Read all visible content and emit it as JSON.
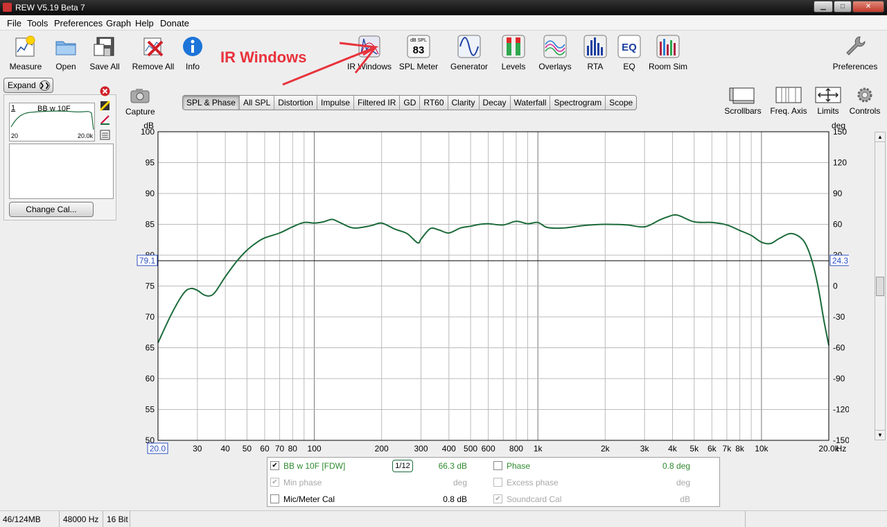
{
  "window": {
    "title": "REW V5.19 Beta 7"
  },
  "menu": [
    "File",
    "Tools",
    "Preferences",
    "Graph",
    "Help",
    "Donate"
  ],
  "toolbar": {
    "measure": "Measure",
    "open": "Open",
    "save_all": "Save All",
    "remove_all": "Remove All",
    "info": "Info",
    "ir_windows": "IR Windows",
    "spl_meter": "SPL Meter",
    "spl_meter_icon_top": "dB SPL",
    "spl_meter_icon_value": "83",
    "generator": "Generator",
    "levels": "Levels",
    "overlays": "Overlays",
    "rta": "RTA",
    "eq": "EQ",
    "eq_icon_text": "EQ",
    "room_sim": "Room Sim",
    "preferences": "Preferences"
  },
  "annotation": {
    "text": "IR Windows",
    "color": "#e8323c"
  },
  "left_panel": {
    "expand": "Expand",
    "measurement": {
      "number": "1",
      "name": "BB w 10F",
      "f_min": "20",
      "f_max": "20.0k"
    },
    "change_cal": "Change Cal..."
  },
  "capture": "Capture",
  "graph_tabs": [
    "SPL & Phase",
    "All SPL",
    "Distortion",
    "Impulse",
    "Filtered IR",
    "GD",
    "RT60",
    "Clarity",
    "Decay",
    "Waterfall",
    "Spectrogram",
    "Scope"
  ],
  "active_tab": "SPL & Phase",
  "right_tools": {
    "scrollbars": "Scrollbars",
    "freq_axis": "Freq. Axis",
    "limits": "Limits",
    "controls": "Controls"
  },
  "chart_data": {
    "type": "line",
    "x_scale": "log",
    "xlim": [
      20,
      20000
    ],
    "ylim": [
      50,
      100
    ],
    "y2lim": [
      -150,
      150
    ],
    "ylabel": "dB",
    "y2label": "deg",
    "xunit": "Hz",
    "y_ticks": [
      "100",
      "95",
      "90",
      "85",
      "80",
      "75",
      "70",
      "65",
      "60",
      "55",
      "50"
    ],
    "y2_ticks": [
      "150",
      "120",
      "90",
      "60",
      "30",
      "0",
      "-30",
      "-60",
      "-90",
      "-120",
      "-150"
    ],
    "x_tick_labels": [
      {
        "f": 30,
        "label": "30"
      },
      {
        "f": 40,
        "label": "40"
      },
      {
        "f": 50,
        "label": "50"
      },
      {
        "f": 60,
        "label": "60"
      },
      {
        "f": 70,
        "label": "70"
      },
      {
        "f": 80,
        "label": "80"
      },
      {
        "f": 100,
        "label": "100"
      },
      {
        "f": 200,
        "label": "200"
      },
      {
        "f": 300,
        "label": "300"
      },
      {
        "f": 400,
        "label": "400"
      },
      {
        "f": 500,
        "label": "500"
      },
      {
        "f": 600,
        "label": "600"
      },
      {
        "f": 800,
        "label": "800"
      },
      {
        "f": 1000,
        "label": "1k"
      },
      {
        "f": 2000,
        "label": "2k"
      },
      {
        "f": 3000,
        "label": "3k"
      },
      {
        "f": 4000,
        "label": "4k"
      },
      {
        "f": 5000,
        "label": "5k"
      },
      {
        "f": 6000,
        "label": "6k"
      },
      {
        "f": 7000,
        "label": "7k"
      },
      {
        "f": 8000,
        "label": "8k"
      },
      {
        "f": 10000,
        "label": "10k"
      },
      {
        "f": 20000,
        "label": "20.0k"
      }
    ],
    "x_start_label": "20.0",
    "cursor": {
      "db": 79.1,
      "db_label": "79.1",
      "deg_label": "24.3"
    },
    "series": [
      {
        "name": "BB w 10F [FDW]",
        "color": "#1b6b3a",
        "x": [
          20,
          23,
          26,
          28,
          30,
          32,
          34,
          36,
          40,
          45,
          50,
          55,
          60,
          70,
          80,
          90,
          100,
          110,
          120,
          130,
          150,
          180,
          200,
          230,
          260,
          290,
          300,
          330,
          360,
          400,
          450,
          500,
          550,
          600,
          700,
          800,
          900,
          1000,
          1100,
          1300,
          1600,
          2000,
          2500,
          3000,
          3500,
          3800,
          4200,
          5000,
          6000,
          7000,
          8000,
          9000,
          10000,
          11000,
          12000,
          13500,
          15000,
          16000,
          17000,
          18000,
          19000,
          20000
        ],
        "y": [
          65.8,
          70.5,
          73.8,
          74.6,
          74.3,
          73.6,
          73.4,
          74.0,
          76.5,
          79.0,
          80.8,
          82.0,
          82.8,
          83.6,
          84.6,
          85.3,
          85.2,
          85.4,
          85.8,
          85.3,
          84.4,
          84.8,
          85.2,
          84.2,
          83.5,
          82.0,
          82.6,
          84.3,
          84.1,
          83.6,
          84.4,
          84.7,
          85.0,
          85.1,
          84.9,
          85.5,
          85.1,
          85.3,
          84.5,
          84.4,
          84.8,
          85.0,
          84.9,
          84.6,
          85.7,
          86.2,
          86.5,
          85.4,
          85.3,
          84.9,
          84.0,
          83.2,
          82.1,
          81.9,
          82.7,
          83.5,
          82.8,
          81.3,
          78.5,
          74.5,
          69.5,
          65.4
        ]
      }
    ]
  },
  "bottom_panel": {
    "meas_name": "BB w 10F [FDW]",
    "smoothing": "1/12",
    "spl_value": "66.3 dB",
    "phase": "Phase",
    "phase_value": "0.8 deg",
    "min_phase": "Min phase",
    "min_phase_unit": "deg",
    "excess_phase": "Excess phase",
    "excess_phase_unit": "deg",
    "mic_cal": "Mic/Meter Cal",
    "mic_cal_value": "0.8 dB",
    "soundcard_cal": "Soundcard Cal",
    "soundcard_cal_unit": "dB"
  },
  "status": {
    "memory": "46/124MB",
    "sample_rate": "48000 Hz",
    "bit_depth": "16 Bit"
  }
}
